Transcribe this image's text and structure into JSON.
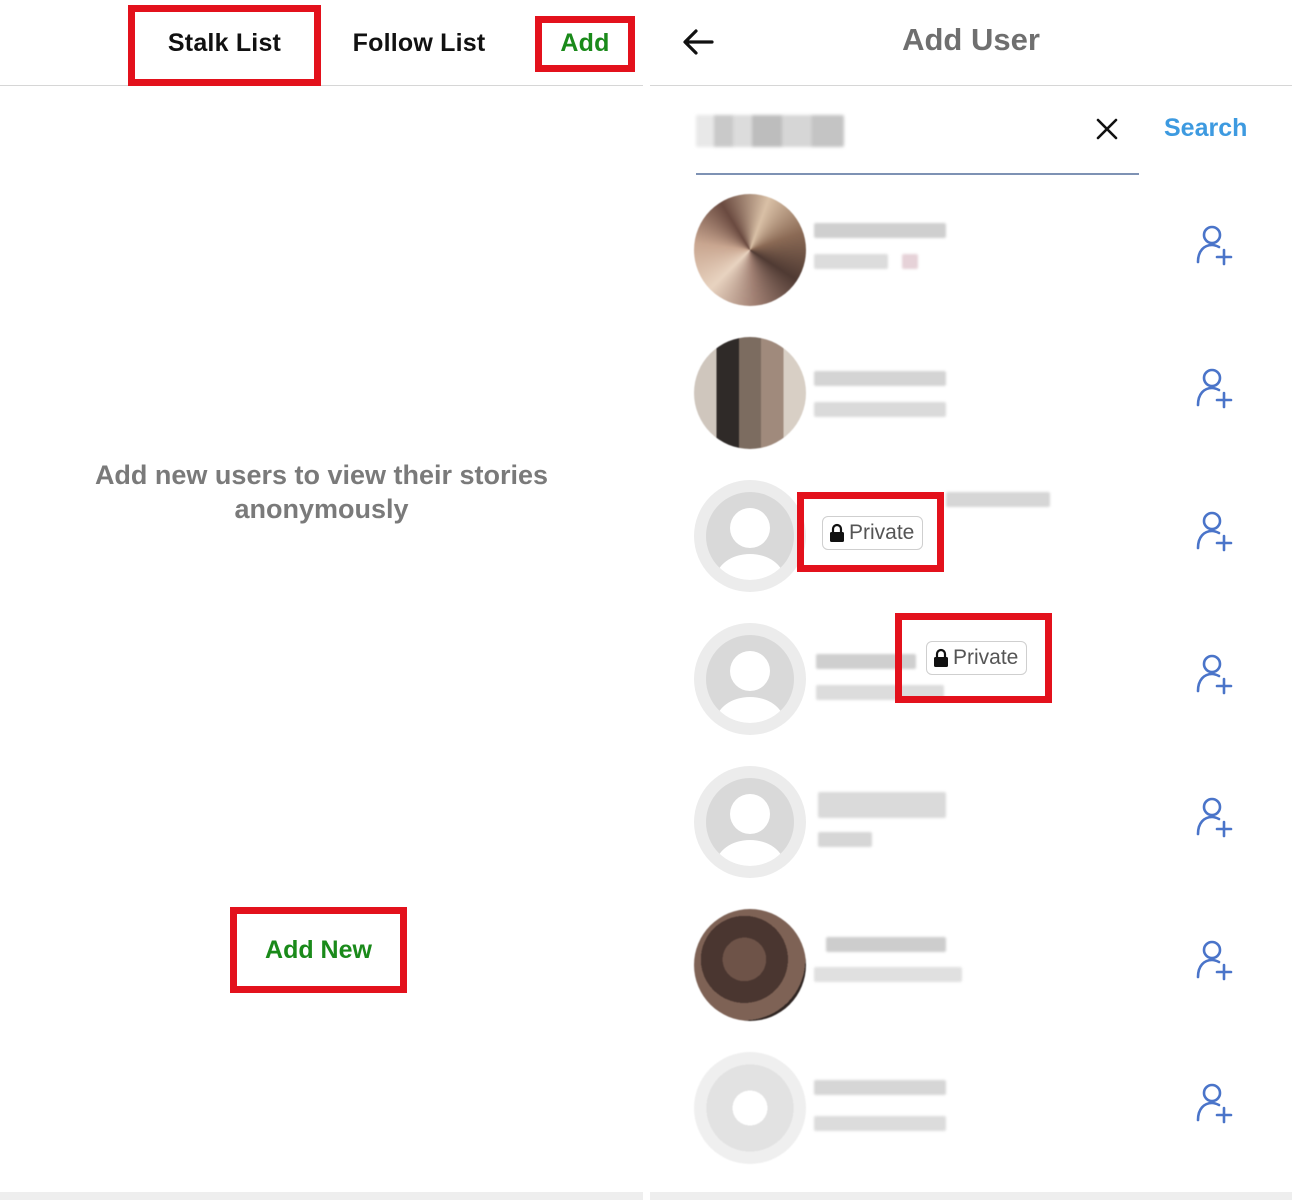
{
  "left": {
    "tabs": [
      {
        "label": "Stalk List"
      },
      {
        "label": "Follow List"
      }
    ],
    "add_label": "Add",
    "empty_message": "Add new users to view their stories anonymously",
    "add_new_label": "Add New"
  },
  "right": {
    "title": "Add User",
    "search_button": "Search",
    "search_value": "",
    "users": [
      {
        "avatar": "photo",
        "private": false
      },
      {
        "avatar": "photo",
        "private": false
      },
      {
        "avatar": "default",
        "private": true,
        "badge_label": "Private"
      },
      {
        "avatar": "default",
        "private": true,
        "badge_label": "Private"
      },
      {
        "avatar": "default",
        "private": false
      },
      {
        "avatar": "photo",
        "private": false
      },
      {
        "avatar": "photo",
        "private": false
      }
    ]
  },
  "icons": {
    "back": "arrow-left-icon",
    "clear": "close-icon",
    "follow": "user-plus-icon",
    "lock": "lock-icon"
  },
  "colors": {
    "highlight": "#e3111c",
    "green_action": "#1a8a1a",
    "search_blue": "#3d9ae0",
    "icon_blue": "#4a74c9",
    "title_gray": "#6f6f6f"
  }
}
